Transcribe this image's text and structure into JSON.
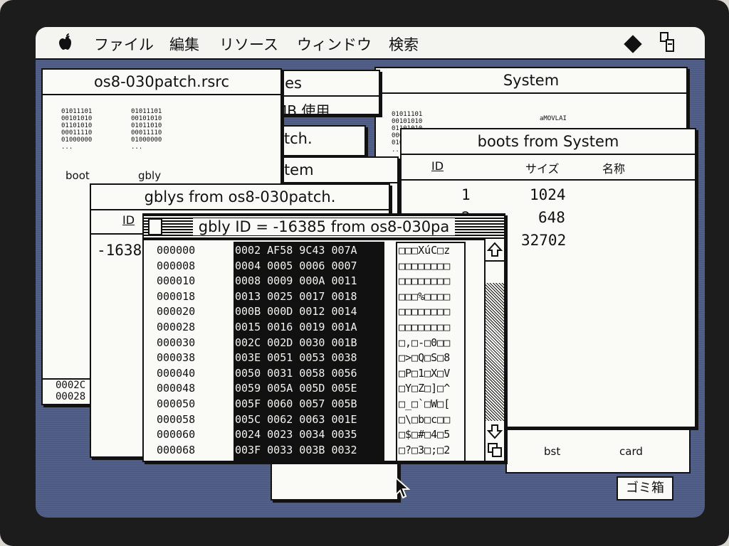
{
  "menubar": {
    "items": [
      "ファイル",
      "編集",
      "リソース",
      "ウィンドウ",
      "検索"
    ]
  },
  "windows": {
    "os8": {
      "title": "os8-030patch.rsrc",
      "icons": [
        {
          "bits": "01011101\n00101010\n01101010\n00011110\n01000000\n...",
          "label": "boot"
        },
        {
          "bits": "01011101\n00101010\n01011010\n00011110\n01000000\n...",
          "label": "gbly"
        }
      ],
      "bottom_rows": [
        "0002C",
        "00028"
      ]
    },
    "properties": {
      "title_fragment": "ties",
      "line": "MB 使用"
    },
    "patch": {
      "title_fragment": "atch."
    },
    "stem": {
      "title_fragment": "stem"
    },
    "system": {
      "title": "System",
      "icon_bits": "01011101\n00101010\n01101010\n00011110\n01000000\n...",
      "icon_caption": "aMOVLAI",
      "bottom_labels": [
        "bst",
        "card"
      ]
    },
    "boots": {
      "title": "boots from System",
      "col_id": "ID",
      "col_size": "サイズ",
      "col_name": "名称",
      "rows": [
        {
          "id": "1",
          "size": "1024"
        },
        {
          "id": "2",
          "size": "648"
        },
        {
          "id": "",
          "size": "32702"
        }
      ]
    },
    "gblys": {
      "title": "gblys from os8-030patch.",
      "col_id": "ID",
      "row_id_fragment": "-1638"
    },
    "hex": {
      "title": "gbly ID = -16385 from os8-030pa",
      "offsets": [
        "000000",
        "000008",
        "000010",
        "000018",
        "000020",
        "000028",
        "000030",
        "000038",
        "000040",
        "000048",
        "000050",
        "000058",
        "000060",
        "000068"
      ],
      "hex_rows": [
        "0002 AF58 9C43 007A",
        "0004 0005 0006 0007",
        "0008 0009 000A 0011",
        "0013 0025 0017 0018",
        "000B 000D 0012 0014",
        "0015 0016 0019 001A",
        "002C 002D 0030 001B",
        "003E 0051 0053 0038",
        "0050 0031 0058 0056",
        "0059 005A 005D 005E",
        "005F 0060 0057 005B",
        "005C 0062 0063 001E",
        "0024 0023 0034 0035",
        "003F 0033 003B 0032"
      ],
      "ascii_rows": [
        "□□□XúC□z",
        "□□□□□□□□",
        "□□□□□□□□",
        "□□□%□□□□",
        "□□□□□□□□",
        "□□□□□□□□",
        "□,□-□0□□",
        "□>□Q□S□8",
        "□P□1□X□V",
        "□Y□Z□]□^",
        "□_□`□W□[",
        "□\\□b□c□□",
        "□$□#□4□5",
        "□?□3□;□2"
      ]
    }
  },
  "trash": {
    "label": "ゴミ箱"
  }
}
